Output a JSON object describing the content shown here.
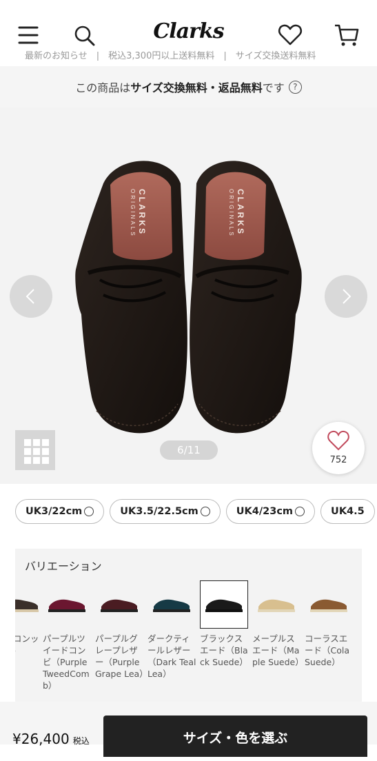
{
  "header": {
    "logo": "Clarks",
    "banner_text": "最新のお知らせ　|　税込3,300円以上送料無料　|　サイズ交換送料無料"
  },
  "notice": {
    "prefix": "この商品は ",
    "bold": "サイズ交換無料・返品無料",
    "suffix": " です",
    "help": "?"
  },
  "gallery": {
    "counter": "6/11",
    "favorite_count": "752",
    "insole_brand_1": "CLARKS",
    "insole_brand_2": "ORIGINALS"
  },
  "sizes": [
    {
      "label": "UK3/22cm"
    },
    {
      "label": "UK3.5/22.5cm"
    },
    {
      "label": "UK4/23cm"
    },
    {
      "label": "UK4.5"
    }
  ],
  "variation": {
    "title": "バリエーション",
    "items": [
      {
        "name": "クツコンックCo",
        "color": "#3a2f2a"
      },
      {
        "name": "パープルツイードコンビ（Purple TweedComb）",
        "color": "#6b1730"
      },
      {
        "name": "パープルグレープレザー（Purple Grape Lea）",
        "color": "#4a1c22"
      },
      {
        "name": "ダークティールレザー（Dark Teal Lea）",
        "color": "#163a45"
      },
      {
        "name": "ブラックスエード（Black Suede）",
        "color": "#1a1a1a"
      },
      {
        "name": "メープルスエード（Maple Suede）",
        "color": "#d8bf8f"
      },
      {
        "name": "コーラスエード（Cola Suede）",
        "color": "#8a5a32"
      }
    ]
  },
  "bottom": {
    "price": "¥26,400",
    "tax": "税込",
    "cta": "サイズ・色を選ぶ"
  }
}
